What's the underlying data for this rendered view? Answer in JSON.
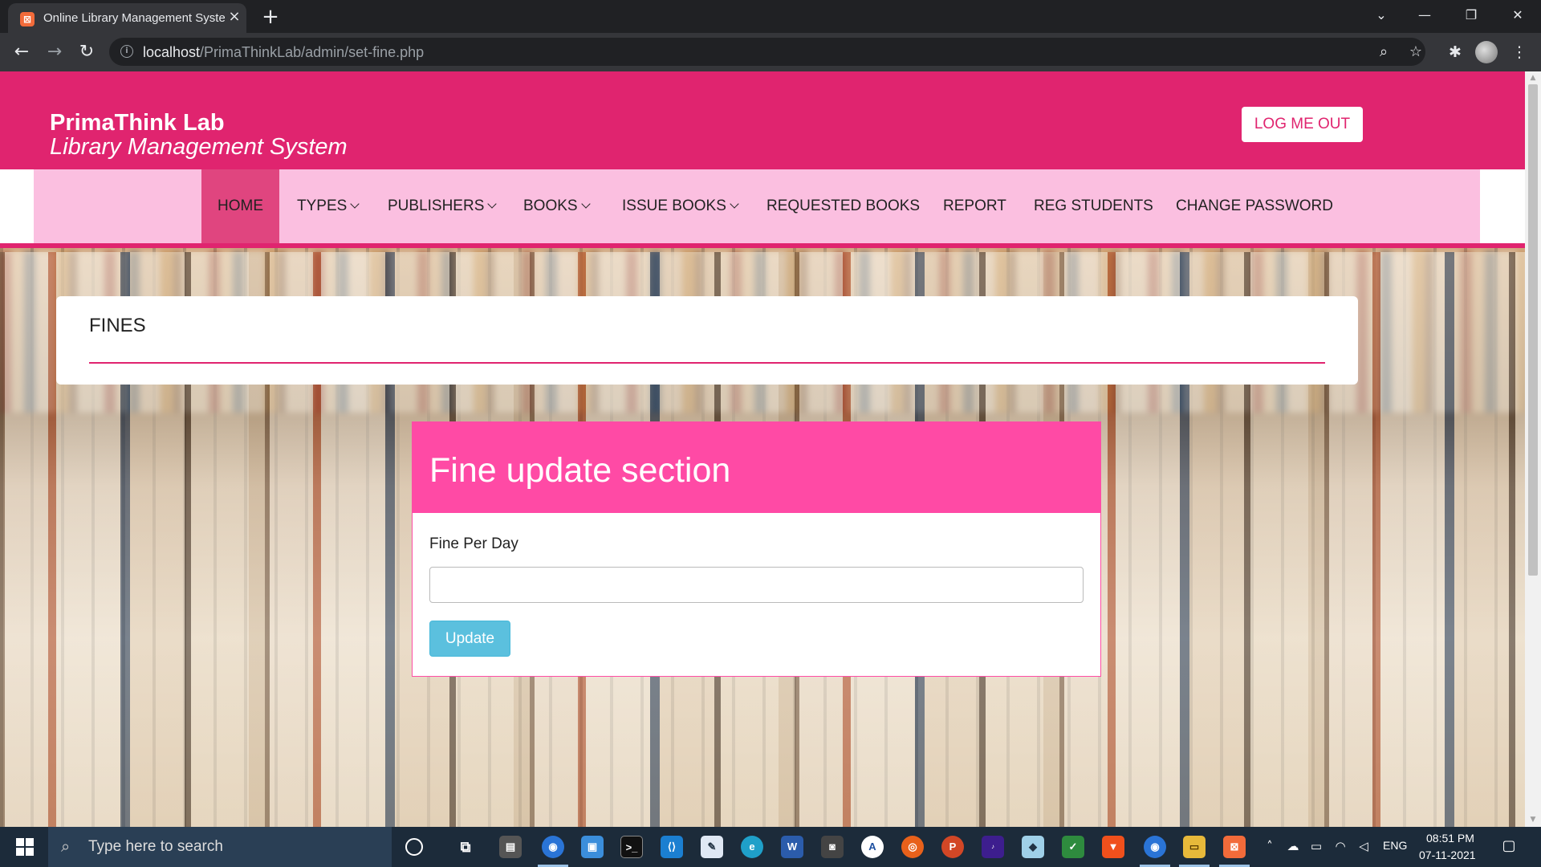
{
  "browser": {
    "tab_title": "Online Library Management System",
    "tab_favicon": "xampp-icon",
    "url_host": "localhost",
    "url_path": "/PrimaThinkLab/admin/set-fine.php"
  },
  "header": {
    "brand_name": "PrimaThink Lab",
    "brand_subtitle": "Library Management System",
    "logout_label": "LOG ME OUT"
  },
  "nav": {
    "items": [
      {
        "label": "HOME",
        "active": true,
        "dropdown": false
      },
      {
        "label": "TYPES",
        "active": false,
        "dropdown": true
      },
      {
        "label": "PUBLISHERS",
        "active": false,
        "dropdown": true
      },
      {
        "label": "BOOKS",
        "active": false,
        "dropdown": true
      },
      {
        "label": "ISSUE BOOKS",
        "active": false,
        "dropdown": true
      },
      {
        "label": "REQUESTED BOOKS",
        "active": false,
        "dropdown": false
      },
      {
        "label": "REPORT",
        "active": false,
        "dropdown": false
      },
      {
        "label": "REG STUDENTS",
        "active": false,
        "dropdown": false
      },
      {
        "label": "CHANGE PASSWORD",
        "active": false,
        "dropdown": false
      }
    ]
  },
  "page": {
    "section_title": "FINES"
  },
  "fine_panel": {
    "title": "Fine update section",
    "field_label": "Fine Per Day",
    "field_value": "",
    "update_label": "Update"
  },
  "taskbar": {
    "search_placeholder": "Type here to search",
    "language": "ENG",
    "time": "08:51 PM",
    "date": "07-11-2021"
  },
  "colors": {
    "brand_pink": "#e0246f",
    "nav_bg": "#fbbfe0",
    "panel_header": "#ff4aa5",
    "update_button": "#5bc0de"
  }
}
